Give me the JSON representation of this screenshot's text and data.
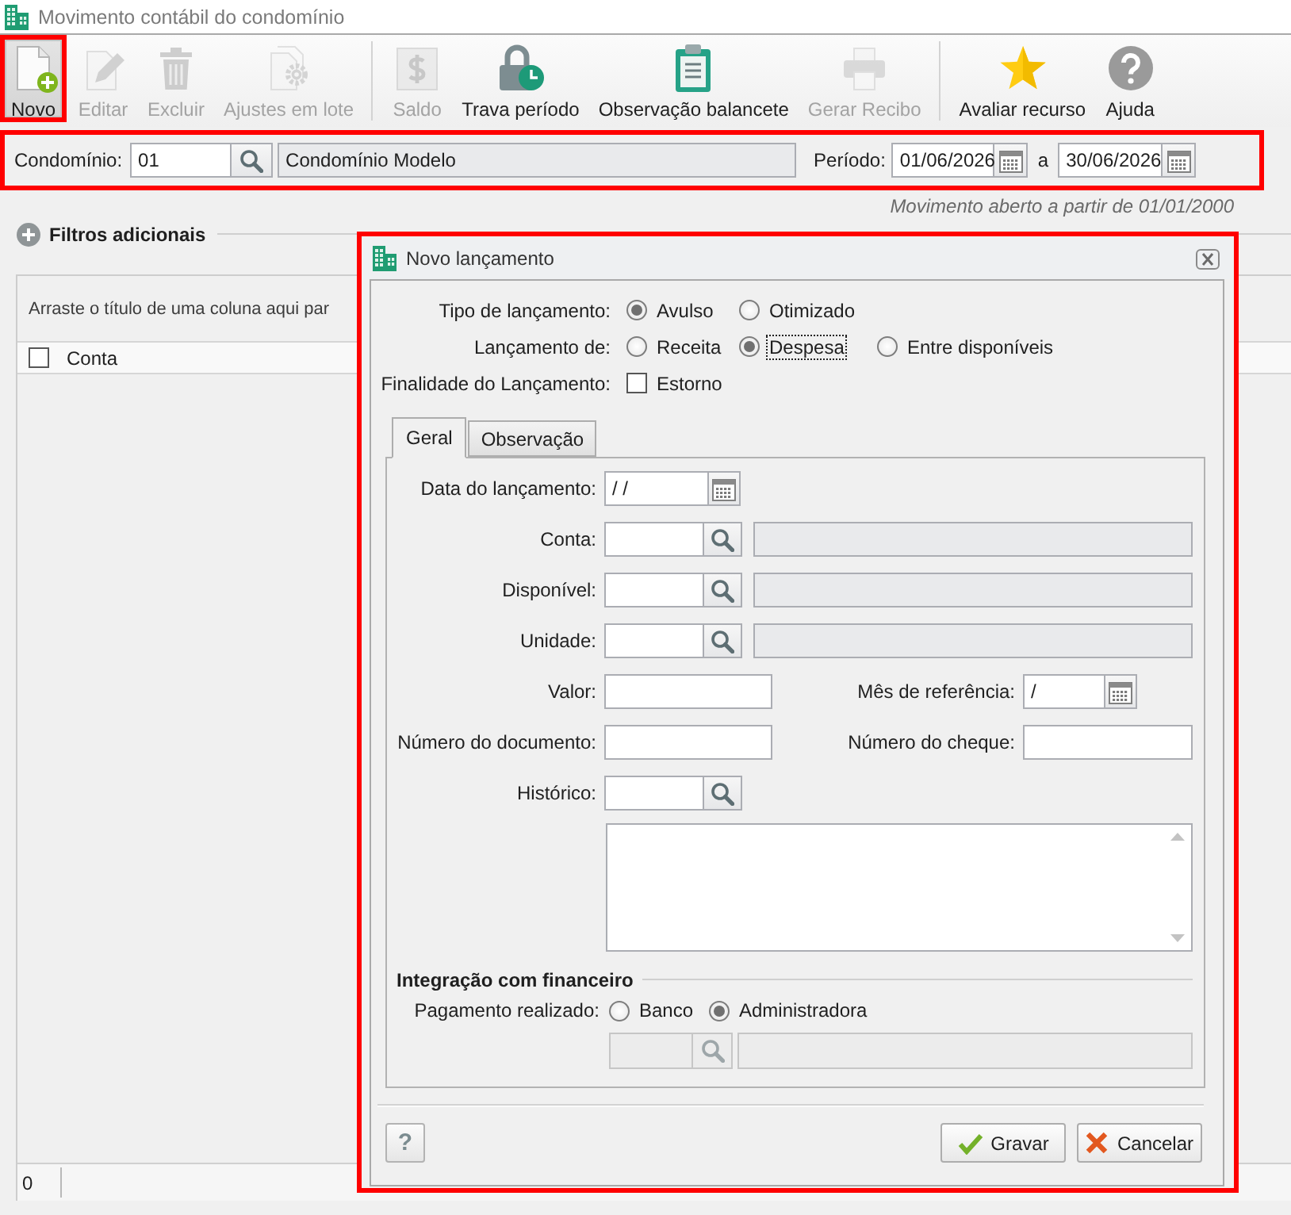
{
  "window": {
    "title": "Movimento contábil do condomínio"
  },
  "toolbar": {
    "groups": [
      [
        {
          "label": "Novo",
          "disabled": false,
          "pressed": true,
          "annotated": true
        },
        {
          "label": "Editar",
          "disabled": true,
          "pressed": false,
          "annotated": false
        },
        {
          "label": "Excluir",
          "disabled": true,
          "pressed": false,
          "annotated": false
        },
        {
          "label": "Ajustes em lote",
          "disabled": true,
          "pressed": false,
          "annotated": false
        }
      ],
      [
        {
          "label": "Saldo",
          "disabled": true,
          "pressed": false,
          "annotated": false
        },
        {
          "label": "Trava período",
          "disabled": false,
          "pressed": false,
          "annotated": false
        },
        {
          "label": "Observação balancete",
          "disabled": false,
          "pressed": false,
          "annotated": false
        },
        {
          "label": "Gerar Recibo",
          "disabled": true,
          "pressed": false,
          "annotated": false
        }
      ],
      [
        {
          "label": "Avaliar recurso",
          "disabled": false,
          "pressed": false,
          "annotated": false
        },
        {
          "label": "Ajuda",
          "disabled": false,
          "pressed": false,
          "annotated": false
        }
      ]
    ]
  },
  "filter_bar": {
    "annotated": true,
    "condo_label": "Condomínio:",
    "condo_code": "01",
    "condo_name": "Condomínio Modelo",
    "period_label": "Período:",
    "period_from": "01/06/2026",
    "period_joiner": "a",
    "period_to": "30/06/2026"
  },
  "period_note": "Movimento aberto a partir de 01/01/2000",
  "extra_filters": {
    "label": "Filtros adicionais",
    "expanded": false
  },
  "grid": {
    "group_hint": "Arraste o título de uma coluna aqui par",
    "select_all_checked": false,
    "columns": [
      "Conta"
    ],
    "footer_count": "0"
  },
  "dialog": {
    "title": "Novo lançamento",
    "annotated": true,
    "option_rows": [
      {
        "kind": "radio",
        "label": "Tipo de lançamento:",
        "options": [
          {
            "label": "Avulso",
            "selected": true,
            "focused": false
          },
          {
            "label": "Otimizado",
            "selected": false,
            "focused": false
          }
        ]
      },
      {
        "kind": "radio",
        "label": "Lançamento de:",
        "options": [
          {
            "label": "Receita",
            "selected": false,
            "focused": false
          },
          {
            "label": "Despesa",
            "selected": true,
            "focused": true
          },
          {
            "label": "Entre disponíveis",
            "selected": false,
            "focused": false
          }
        ]
      },
      {
        "kind": "checkbox",
        "label": "Finalidade do Lançamento:",
        "options": [
          {
            "label": "Estorno",
            "checked": false
          }
        ]
      }
    ],
    "tabs": [
      {
        "label": "Geral",
        "selected": true
      },
      {
        "label": "Observação",
        "selected": false
      }
    ],
    "form": {
      "launch_date": {
        "label": "Data do lançamento:",
        "value": "/ /"
      },
      "lookups": [
        {
          "label": "Conta:"
        },
        {
          "label": "Disponível:"
        },
        {
          "label": "Unidade:"
        }
      ],
      "amount": {
        "label": "Valor:"
      },
      "reference_month": {
        "label": "Mês de referência:",
        "value": "/"
      },
      "document_number": {
        "label": "Número do documento:"
      },
      "check_number": {
        "label": "Número do cheque:"
      },
      "history": {
        "label": "Histórico:"
      }
    },
    "financial": {
      "title": "Integração com financeiro",
      "payment_label": "Pagamento realizado:",
      "payment_options": [
        {
          "label": "Banco",
          "selected": false
        },
        {
          "label": "Administradora",
          "selected": true
        }
      ],
      "account_disabled": true
    },
    "help_button": "?",
    "buttons": [
      {
        "label": "Gravar"
      },
      {
        "label": "Cancelar"
      }
    ]
  }
}
